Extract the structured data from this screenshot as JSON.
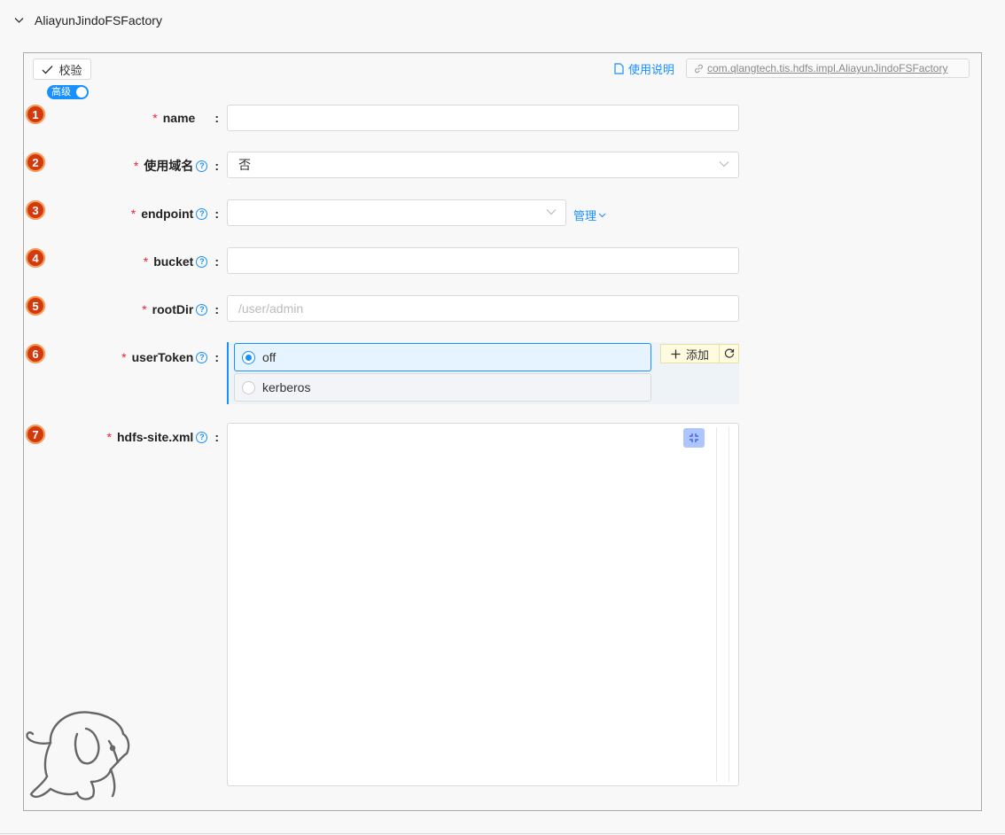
{
  "panel": {
    "title": "AliayunJindoFSFactory"
  },
  "toolbar": {
    "verify_label": "校验",
    "advanced_label": "高级",
    "doc_label": "使用说明",
    "class_name": "com.qlangtech.tis.hdfs.impl.AliayunJindoFSFactory"
  },
  "fields": [
    {
      "index": "1",
      "label": "name",
      "required": true,
      "help": false,
      "value": ""
    },
    {
      "index": "2",
      "label": "使用域名",
      "required": true,
      "help": true,
      "value": "否"
    },
    {
      "index": "3",
      "label": "endpoint",
      "required": true,
      "help": true,
      "value": ""
    },
    {
      "index": "4",
      "label": "bucket",
      "required": true,
      "help": true,
      "value": ""
    },
    {
      "index": "5",
      "label": "rootDir",
      "required": true,
      "help": true,
      "value": "",
      "placeholder": "/user/admin"
    },
    {
      "index": "6",
      "label": "userToken",
      "required": true,
      "help": true
    },
    {
      "index": "7",
      "label": "hdfs-site.xml",
      "required": true,
      "help": true,
      "value": ""
    }
  ],
  "endpoint_manage": "管理",
  "userToken": {
    "options": [
      "off",
      "kerberos"
    ],
    "selected": "off",
    "add_label": "添加"
  },
  "colors": {
    "accent": "#1890ff",
    "required": "#f5222d",
    "badge": "#d4380d"
  }
}
